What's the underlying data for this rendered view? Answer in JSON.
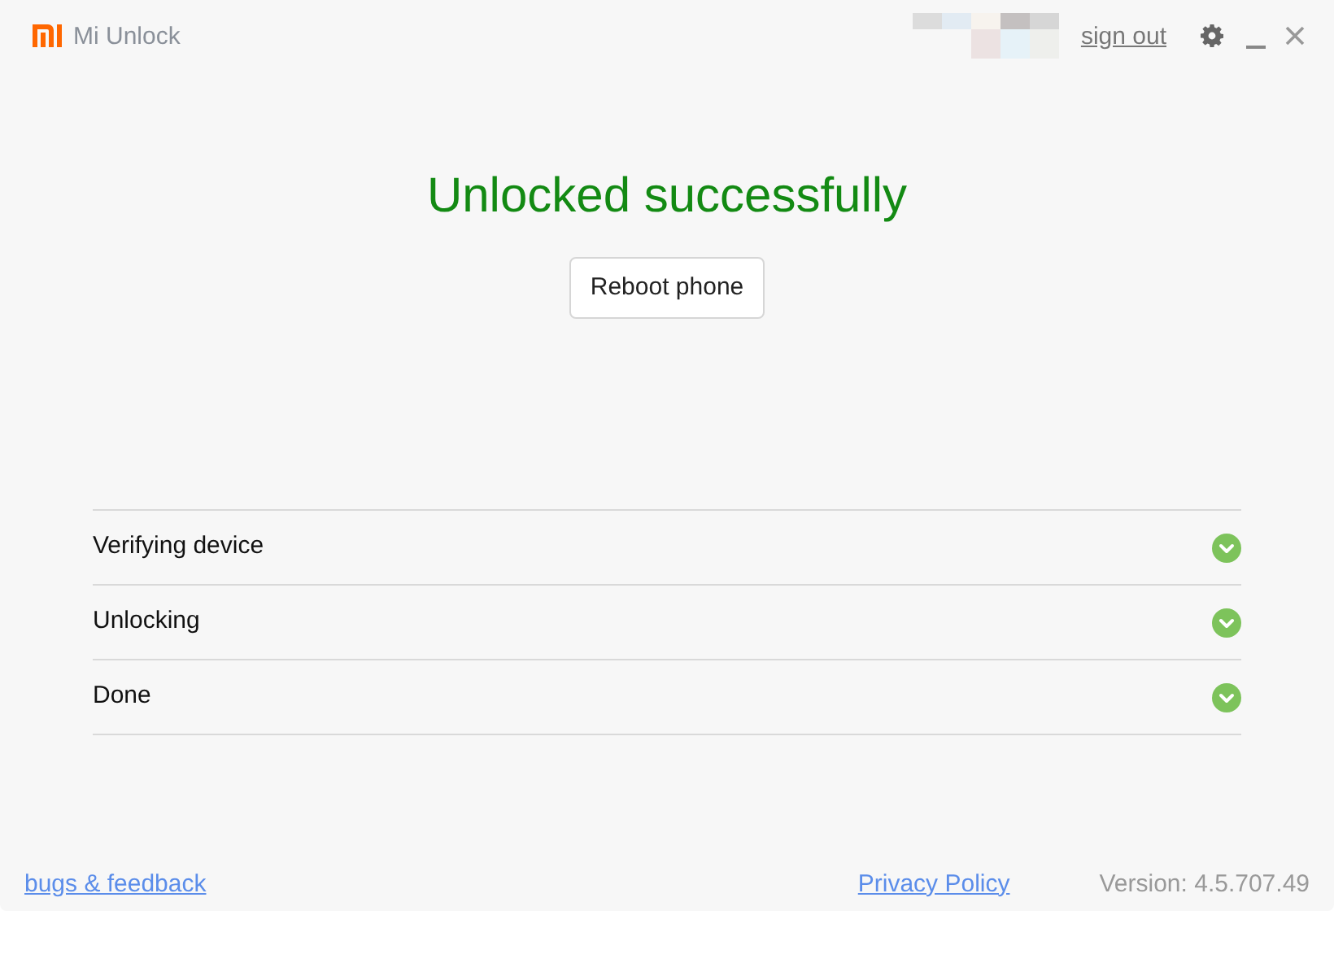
{
  "window": {
    "title": "Mi Unlock"
  },
  "account": {
    "action": "sign out"
  },
  "status": {
    "title": "Unlocked successfully"
  },
  "button": {
    "label": "Reboot phone"
  },
  "steps": [
    {
      "label": "Verifying device",
      "done": true
    },
    {
      "label": "Unlocking",
      "done": true
    },
    {
      "label": "Done",
      "done": true
    }
  ],
  "footer": {
    "links": [
      "bugs & feedback",
      "Privacy Policy"
    ],
    "version": "Version: 4.5.707.49"
  }
}
